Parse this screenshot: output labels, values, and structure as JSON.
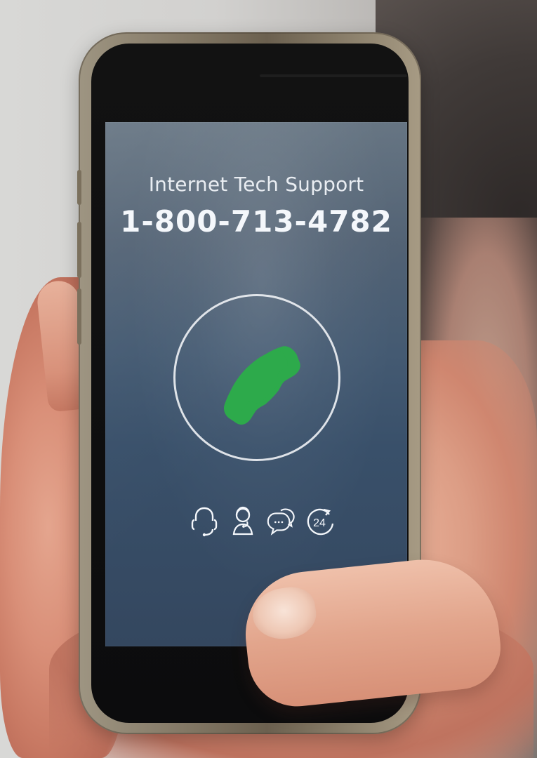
{
  "screen": {
    "support_label": "Internet Tech Support",
    "phone_number": "1-800-713-4782"
  },
  "icons": {
    "call": "phone-icon",
    "support_row": [
      "headset-icon",
      "support-agent-icon",
      "chat-icon",
      "24-hour-icon"
    ],
    "hour_text": "24"
  },
  "colors": {
    "call_green": "#2daa4b",
    "screen_blue": "#3b516a",
    "text_white": "#f4f7fb"
  }
}
